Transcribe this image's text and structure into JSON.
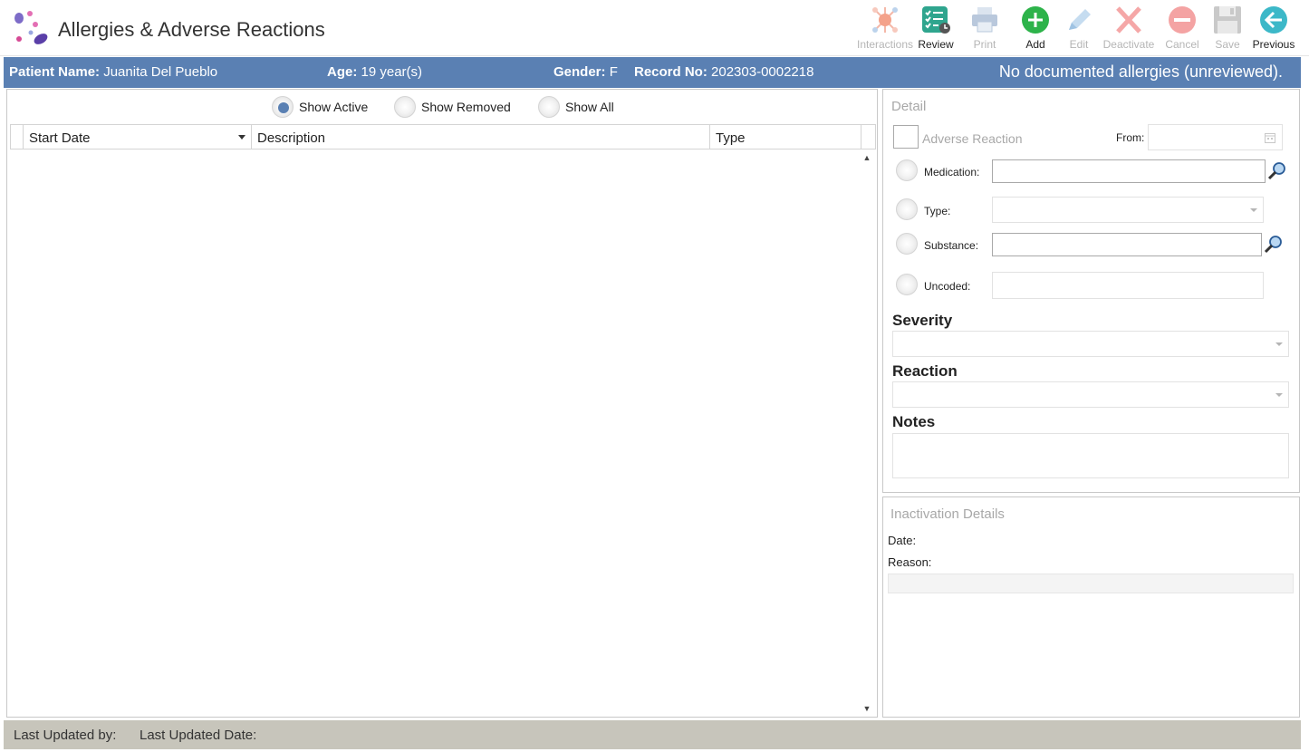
{
  "header": {
    "title": "Allergies & Adverse Reactions",
    "toolbar": [
      {
        "id": "interactions",
        "label": "Interactions",
        "icon": "interactions-icon",
        "enabled": false
      },
      {
        "id": "review",
        "label": "Review",
        "icon": "review-checklist-icon",
        "enabled": true
      },
      {
        "id": "print",
        "label": "Print",
        "icon": "printer-icon",
        "enabled": false
      },
      {
        "id": "add",
        "label": "Add",
        "icon": "plus-circle-icon",
        "enabled": true
      },
      {
        "id": "edit",
        "label": "Edit",
        "icon": "pencil-icon",
        "enabled": false
      },
      {
        "id": "deactivate",
        "label": "Deactivate",
        "icon": "x-mark-icon",
        "enabled": false
      },
      {
        "id": "cancel",
        "label": "Cancel",
        "icon": "minus-circle-icon",
        "enabled": false
      },
      {
        "id": "save",
        "label": "Save",
        "icon": "floppy-disk-icon",
        "enabled": false
      },
      {
        "id": "previous",
        "label": "Previous",
        "icon": "arrow-left-circle-icon",
        "enabled": true
      }
    ]
  },
  "patient": {
    "name_label": "Patient Name:",
    "name": "Juanita Del Pueblo",
    "age_label": "Age:",
    "age": "19 year(s)",
    "gender_label": "Gender:",
    "gender": "F",
    "record_label": "Record No:",
    "record": "202303-0002218",
    "allergy_status": "No documented allergies (unreviewed)."
  },
  "list": {
    "filters": [
      {
        "label": "Show Active",
        "checked": true
      },
      {
        "label": "Show Removed",
        "checked": false
      },
      {
        "label": "Show All",
        "checked": false
      }
    ],
    "columns": [
      "Start Date",
      "Description",
      "Type"
    ],
    "rows": []
  },
  "detail": {
    "title": "Detail",
    "adverse_reaction_label": "Adverse Reaction",
    "from_label": "From:",
    "medication_label": "Medication:",
    "type_label": "Type:",
    "substance_label": "Substance:",
    "uncoded_label": "Uncoded:",
    "severity_label": "Severity",
    "reaction_label": "Reaction",
    "notes_label": "Notes"
  },
  "inactivation": {
    "title": "Inactivation Details",
    "date_label": "Date:",
    "reason_label": "Reason:"
  },
  "footer": {
    "last_updated_by_label": "Last Updated by:",
    "last_updated_date_label": "Last Updated Date:"
  },
  "colors": {
    "patient_bar": "#5a80b3",
    "footer": "#c7c5bb",
    "add_green": "#2db34a",
    "previous_teal": "#3cb8c8",
    "review_teal": "#2fa58e"
  }
}
